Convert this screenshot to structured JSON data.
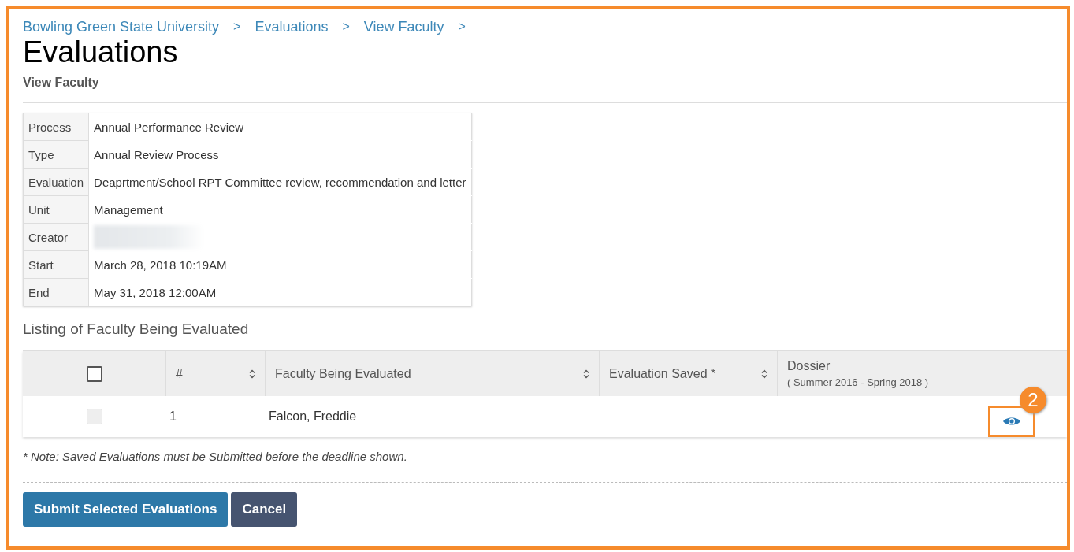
{
  "breadcrumb": {
    "items": [
      "Bowling Green State University",
      "Evaluations",
      "View Faculty"
    ],
    "separator": ">"
  },
  "title": "Evaluations",
  "subtitle": "View Faculty",
  "details": [
    {
      "label": "Process",
      "value": "Annual Performance Review",
      "kind": "text"
    },
    {
      "label": "Type",
      "value": "Annual Review Process",
      "kind": "text"
    },
    {
      "label": "Evaluation",
      "value": "Deaprtment/School RPT Committee review, recommendation and letter",
      "kind": "text"
    },
    {
      "label": "Unit",
      "value": "Management",
      "kind": "text"
    },
    {
      "label": "Creator",
      "kind": "redacted"
    },
    {
      "label": "Start",
      "value": "March 28, 2018 10:19AM",
      "kind": "text"
    },
    {
      "label": "End",
      "value": "May 31, 2018 12:00AM",
      "kind": "text"
    }
  ],
  "listing_title": "Listing of Faculty Being Evaluated",
  "table": {
    "select_all": {
      "checked": false
    },
    "columns": [
      {
        "label": "#",
        "sortable": true
      },
      {
        "label": "Faculty Being Evaluated",
        "sortable": true
      },
      {
        "label": "Evaluation Saved *",
        "sortable": true
      },
      {
        "label": "Dossier",
        "sublabel": "( Summer 2016 - Spring 2018 )",
        "sortable": false
      }
    ],
    "rows": [
      {
        "checked": false,
        "disabled": true,
        "number": "1",
        "faculty": "Falcon, Freddie",
        "callout": "2"
      }
    ]
  },
  "note": "* Note: Saved Evaluations must be Submitted before the deadline shown.",
  "buttons": [
    {
      "label": "Submit Selected Evaluations",
      "kind": "primary"
    },
    {
      "label": "Cancel",
      "kind": "secondary"
    }
  ]
}
